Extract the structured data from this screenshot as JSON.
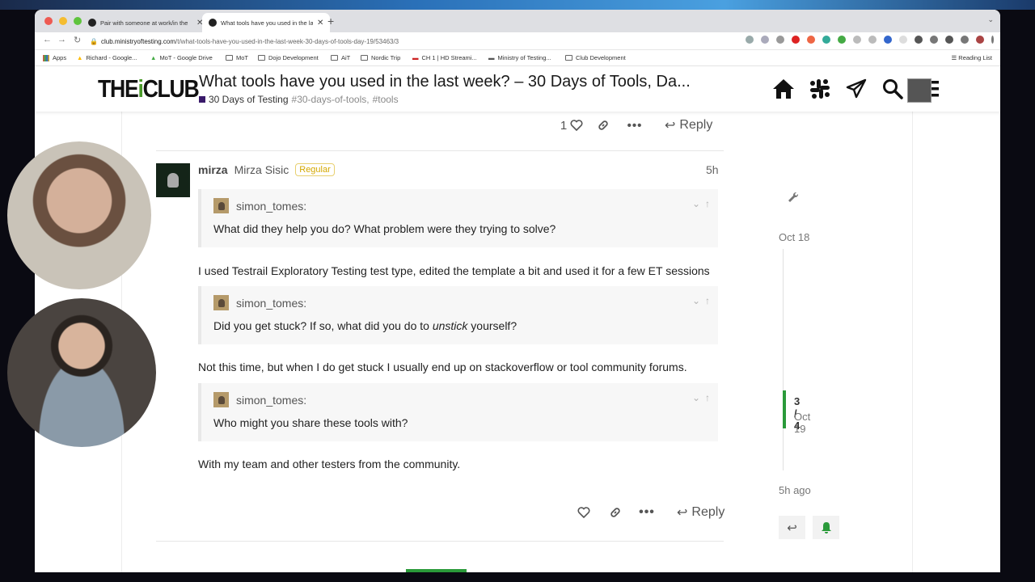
{
  "browser": {
    "tabs": [
      {
        "title": "Pair with someone at work/in the",
        "active": false
      },
      {
        "title": "What tools have you used in the la",
        "active": true
      }
    ],
    "url_domain": "club.ministryoftesting.com",
    "url_path": "/t/what-tools-have-you-used-in-the-last-week-30-days-of-tools-day-19/53463/3",
    "bookmarks": [
      "Apps",
      "Richard - Google...",
      "MoT - Google Drive",
      "MoT",
      "Dojo Development",
      "AiT",
      "Nordic Trip",
      "CH 1 | HD Streami...",
      "Ministry of Testing...",
      "Club Development"
    ],
    "reading_list": "Reading List"
  },
  "site": {
    "logo_prefix": "THE",
    "logo_mark": "i",
    "logo_suffix": "CLUB",
    "topic_title": "What tools have you used in the last week? – 30 Days of Tools, Da...",
    "category": "30 Days of Testing",
    "tags": [
      "#30-days-of-tools,",
      "#tools"
    ]
  },
  "previous_post": {
    "like_count": "1",
    "reply_label": "Reply"
  },
  "post": {
    "username": "mirza",
    "full_name": "Mirza Sisic",
    "badge": "Regular",
    "age": "5h",
    "quotes": [
      {
        "author": "simon_tomes:",
        "text": "What did they help you do? What problem were they trying to solve?"
      },
      {
        "author": "simon_tomes:",
        "text_before": "Did you get stuck? If so, what did you do to ",
        "text_em": "unstick",
        "text_after": " yourself?"
      },
      {
        "author": "simon_tomes:",
        "text": "Who might you share these tools with?"
      }
    ],
    "replies": [
      "I used Testrail Exploratory Testing test type, edited the template a bit and used it for a few ET sessions",
      "Not this time, but when I do get stuck I usually end up on stackoverflow or tool community forums.",
      "With my team and other testers from the community."
    ],
    "reply_label": "Reply"
  },
  "timeline": {
    "start_date": "Oct 18",
    "position": "3 / 4",
    "position_date": "Oct 19",
    "end_label": "5h ago"
  },
  "colors": {
    "accent_green": "#2a9a3a",
    "badge_gold": "#d4a800",
    "category_purple": "#3a1a6a"
  }
}
